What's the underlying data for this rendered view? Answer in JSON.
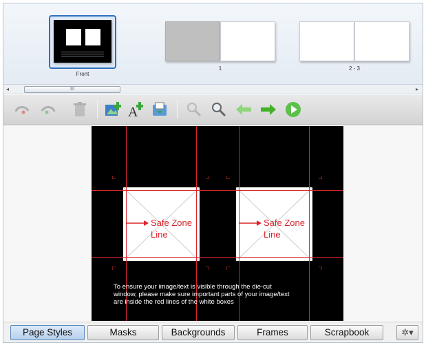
{
  "thumbnails": [
    {
      "caption": "Front"
    },
    {
      "caption": "1"
    },
    {
      "caption": "2 - 3"
    }
  ],
  "scrollbar": {
    "grip": "III",
    "left_arrow": "◂",
    "right_arrow": "▸"
  },
  "toolbar": {
    "icons": [
      "undo-icon",
      "redo-icon",
      "delete-icon",
      "add-photo-icon",
      "add-text-icon",
      "add-page-icon",
      "zoom-out-icon",
      "zoom-in-icon",
      "previous-page-icon",
      "next-page-icon",
      "play-icon"
    ]
  },
  "canvas": {
    "safe_zone_label_1": "Safe Zone",
    "safe_zone_label_2": "Line",
    "note_line_1": "To ensure your image/text is visible through the die-cut",
    "note_line_2": "window, please make sure important parts of your image/text",
    "note_line_3": "are inside the red lines of the white boxes",
    "accent_color": "#d9252b"
  },
  "tabs": [
    {
      "label": "Page Styles",
      "active": true
    },
    {
      "label": "Masks",
      "active": false
    },
    {
      "label": "Backgrounds",
      "active": false
    },
    {
      "label": "Frames",
      "active": false
    },
    {
      "label": "Scrapbook",
      "active": false
    }
  ],
  "gear_menu": {
    "label": "✲▾"
  }
}
